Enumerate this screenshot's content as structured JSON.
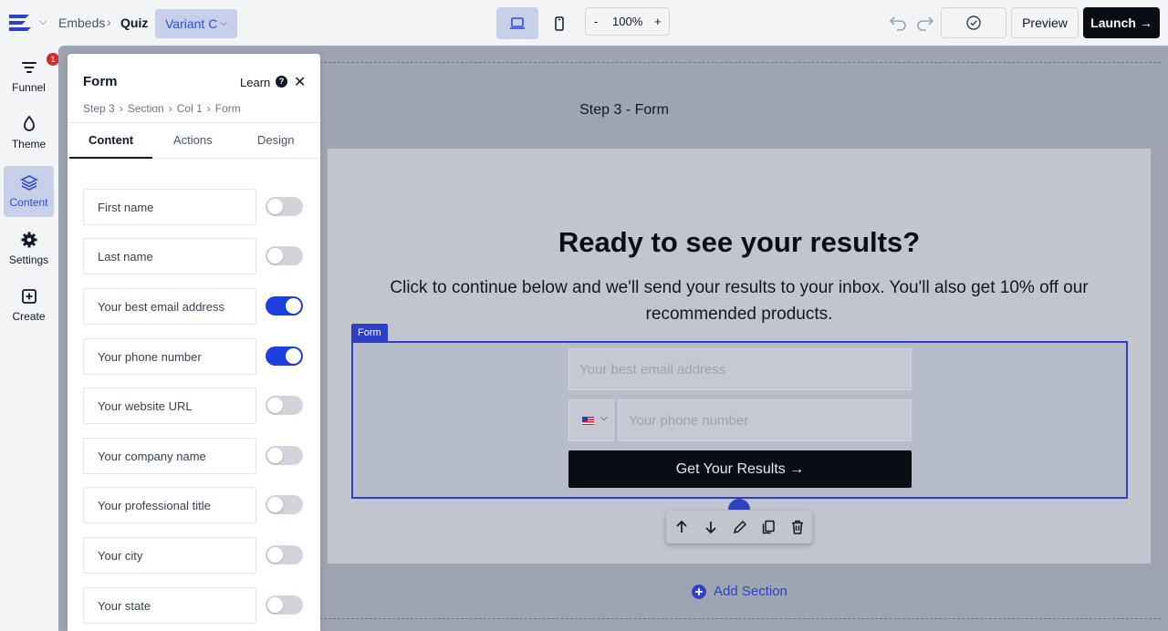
{
  "topbar": {
    "breadcrumb_root": "Embeds",
    "breadcrumb_current": "Quiz",
    "variant_label": "Variant C",
    "zoom_minus": "-",
    "zoom_level": "100%",
    "zoom_plus": "+",
    "preview_label": "Preview",
    "launch_label": "Launch →"
  },
  "rail": {
    "items": [
      {
        "label": "Funnel",
        "icon": "funnel-icon",
        "badge": "1"
      },
      {
        "label": "Theme",
        "icon": "droplet-icon"
      },
      {
        "label": "Content",
        "icon": "layers-icon"
      },
      {
        "label": "Settings",
        "icon": "gear-icon"
      },
      {
        "label": "Create",
        "icon": "plus-square-icon"
      }
    ]
  },
  "panel": {
    "title": "Form",
    "learn_label": "Learn",
    "help_glyph": "?",
    "close_glyph": "✕",
    "breadcrumbs": [
      "Step 3",
      "Section",
      "Col 1",
      "Form"
    ],
    "tabs": [
      "Content",
      "Actions",
      "Design"
    ],
    "active_tab": "Content",
    "fields": [
      {
        "label": "First name",
        "enabled": false
      },
      {
        "label": "Last name",
        "enabled": false
      },
      {
        "label": "Your best email address",
        "enabled": true
      },
      {
        "label": "Your phone number",
        "enabled": true
      },
      {
        "label": "Your website URL",
        "enabled": false
      },
      {
        "label": "Your company name",
        "enabled": false
      },
      {
        "label": "Your professional title",
        "enabled": false
      },
      {
        "label": "Your city",
        "enabled": false
      },
      {
        "label": "Your state",
        "enabled": false
      }
    ]
  },
  "canvas": {
    "step_title": "Step 3 - Form",
    "headline": "Ready to see your results?",
    "subline": "Click to continue below and we'll send your results to your inbox. You'll also get 10% off our recommended products.",
    "form_tag": "Form",
    "email_placeholder": "Your best email address",
    "phone_placeholder": "Your phone number",
    "submit_label": "Get Your Results →",
    "add_section_label": "Add Section"
  },
  "colors": {
    "accent": "#2f40c8",
    "toggle_on": "#1d3fe0",
    "launch_bg": "#0b0d14"
  }
}
